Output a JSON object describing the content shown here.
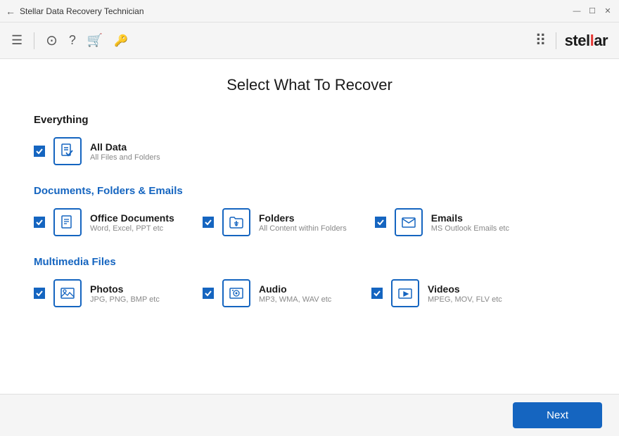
{
  "titleBar": {
    "title": "Stellar Data Recovery Technician",
    "backIcon": "←",
    "minimize": "—",
    "restore": "☐",
    "close": "✕"
  },
  "toolbar": {
    "icons": [
      "☰",
      "⊙",
      "?",
      "🛒",
      "🔑"
    ],
    "gridIcon": "⋮⋮⋮",
    "logoText": "stel",
    "logoAccent": "l",
    "logoEnd": "ar"
  },
  "pageTitle": "Select What To Recover",
  "sections": [
    {
      "id": "everything",
      "title": "Everything",
      "titleColor": "normal",
      "options": [
        {
          "id": "all-data",
          "label": "All Data",
          "sublabel": "All Files and Folders",
          "icon": "document",
          "checked": true
        }
      ]
    },
    {
      "id": "documents",
      "title": "Documents, Folders & Emails",
      "titleColor": "blue",
      "options": [
        {
          "id": "office-docs",
          "label": "Office Documents",
          "sublabel": "Word, Excel, PPT etc",
          "icon": "doc",
          "checked": true
        },
        {
          "id": "folders",
          "label": "Folders",
          "sublabel": "All Content within Folders",
          "icon": "folder",
          "checked": true
        },
        {
          "id": "emails",
          "label": "Emails",
          "sublabel": "MS Outlook Emails etc",
          "icon": "email",
          "checked": true
        }
      ]
    },
    {
      "id": "multimedia",
      "title": "Multimedia Files",
      "titleColor": "blue",
      "options": [
        {
          "id": "photos",
          "label": "Photos",
          "sublabel": "JPG, PNG, BMP etc",
          "icon": "photo",
          "checked": true
        },
        {
          "id": "audio",
          "label": "Audio",
          "sublabel": "MP3, WMA, WAV etc",
          "icon": "audio",
          "checked": true
        },
        {
          "id": "videos",
          "label": "Videos",
          "sublabel": "MPEG, MOV, FLV etc",
          "icon": "video",
          "checked": true
        }
      ]
    }
  ],
  "footer": {
    "nextLabel": "Next"
  }
}
